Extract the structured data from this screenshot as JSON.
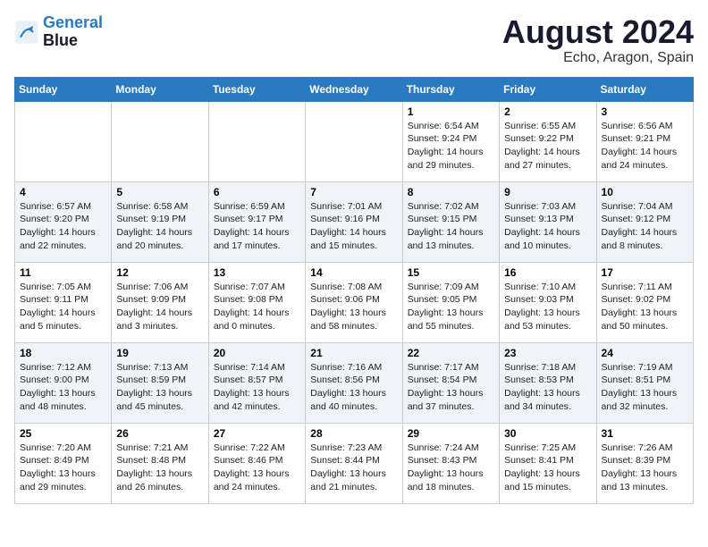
{
  "header": {
    "logo_line1": "General",
    "logo_line2": "Blue",
    "month_title": "August 2024",
    "location": "Echo, Aragon, Spain"
  },
  "days_of_week": [
    "Sunday",
    "Monday",
    "Tuesday",
    "Wednesday",
    "Thursday",
    "Friday",
    "Saturday"
  ],
  "weeks": [
    [
      {
        "day": "",
        "info": ""
      },
      {
        "day": "",
        "info": ""
      },
      {
        "day": "",
        "info": ""
      },
      {
        "day": "",
        "info": ""
      },
      {
        "day": "1",
        "info": "Sunrise: 6:54 AM\nSunset: 9:24 PM\nDaylight: 14 hours\nand 29 minutes."
      },
      {
        "day": "2",
        "info": "Sunrise: 6:55 AM\nSunset: 9:22 PM\nDaylight: 14 hours\nand 27 minutes."
      },
      {
        "day": "3",
        "info": "Sunrise: 6:56 AM\nSunset: 9:21 PM\nDaylight: 14 hours\nand 24 minutes."
      }
    ],
    [
      {
        "day": "4",
        "info": "Sunrise: 6:57 AM\nSunset: 9:20 PM\nDaylight: 14 hours\nand 22 minutes."
      },
      {
        "day": "5",
        "info": "Sunrise: 6:58 AM\nSunset: 9:19 PM\nDaylight: 14 hours\nand 20 minutes."
      },
      {
        "day": "6",
        "info": "Sunrise: 6:59 AM\nSunset: 9:17 PM\nDaylight: 14 hours\nand 17 minutes."
      },
      {
        "day": "7",
        "info": "Sunrise: 7:01 AM\nSunset: 9:16 PM\nDaylight: 14 hours\nand 15 minutes."
      },
      {
        "day": "8",
        "info": "Sunrise: 7:02 AM\nSunset: 9:15 PM\nDaylight: 14 hours\nand 13 minutes."
      },
      {
        "day": "9",
        "info": "Sunrise: 7:03 AM\nSunset: 9:13 PM\nDaylight: 14 hours\nand 10 minutes."
      },
      {
        "day": "10",
        "info": "Sunrise: 7:04 AM\nSunset: 9:12 PM\nDaylight: 14 hours\nand 8 minutes."
      }
    ],
    [
      {
        "day": "11",
        "info": "Sunrise: 7:05 AM\nSunset: 9:11 PM\nDaylight: 14 hours\nand 5 minutes."
      },
      {
        "day": "12",
        "info": "Sunrise: 7:06 AM\nSunset: 9:09 PM\nDaylight: 14 hours\nand 3 minutes."
      },
      {
        "day": "13",
        "info": "Sunrise: 7:07 AM\nSunset: 9:08 PM\nDaylight: 14 hours\nand 0 minutes."
      },
      {
        "day": "14",
        "info": "Sunrise: 7:08 AM\nSunset: 9:06 PM\nDaylight: 13 hours\nand 58 minutes."
      },
      {
        "day": "15",
        "info": "Sunrise: 7:09 AM\nSunset: 9:05 PM\nDaylight: 13 hours\nand 55 minutes."
      },
      {
        "day": "16",
        "info": "Sunrise: 7:10 AM\nSunset: 9:03 PM\nDaylight: 13 hours\nand 53 minutes."
      },
      {
        "day": "17",
        "info": "Sunrise: 7:11 AM\nSunset: 9:02 PM\nDaylight: 13 hours\nand 50 minutes."
      }
    ],
    [
      {
        "day": "18",
        "info": "Sunrise: 7:12 AM\nSunset: 9:00 PM\nDaylight: 13 hours\nand 48 minutes."
      },
      {
        "day": "19",
        "info": "Sunrise: 7:13 AM\nSunset: 8:59 PM\nDaylight: 13 hours\nand 45 minutes."
      },
      {
        "day": "20",
        "info": "Sunrise: 7:14 AM\nSunset: 8:57 PM\nDaylight: 13 hours\nand 42 minutes."
      },
      {
        "day": "21",
        "info": "Sunrise: 7:16 AM\nSunset: 8:56 PM\nDaylight: 13 hours\nand 40 minutes."
      },
      {
        "day": "22",
        "info": "Sunrise: 7:17 AM\nSunset: 8:54 PM\nDaylight: 13 hours\nand 37 minutes."
      },
      {
        "day": "23",
        "info": "Sunrise: 7:18 AM\nSunset: 8:53 PM\nDaylight: 13 hours\nand 34 minutes."
      },
      {
        "day": "24",
        "info": "Sunrise: 7:19 AM\nSunset: 8:51 PM\nDaylight: 13 hours\nand 32 minutes."
      }
    ],
    [
      {
        "day": "25",
        "info": "Sunrise: 7:20 AM\nSunset: 8:49 PM\nDaylight: 13 hours\nand 29 minutes."
      },
      {
        "day": "26",
        "info": "Sunrise: 7:21 AM\nSunset: 8:48 PM\nDaylight: 13 hours\nand 26 minutes."
      },
      {
        "day": "27",
        "info": "Sunrise: 7:22 AM\nSunset: 8:46 PM\nDaylight: 13 hours\nand 24 minutes."
      },
      {
        "day": "28",
        "info": "Sunrise: 7:23 AM\nSunset: 8:44 PM\nDaylight: 13 hours\nand 21 minutes."
      },
      {
        "day": "29",
        "info": "Sunrise: 7:24 AM\nSunset: 8:43 PM\nDaylight: 13 hours\nand 18 minutes."
      },
      {
        "day": "30",
        "info": "Sunrise: 7:25 AM\nSunset: 8:41 PM\nDaylight: 13 hours\nand 15 minutes."
      },
      {
        "day": "31",
        "info": "Sunrise: 7:26 AM\nSunset: 8:39 PM\nDaylight: 13 hours\nand 13 minutes."
      }
    ]
  ]
}
